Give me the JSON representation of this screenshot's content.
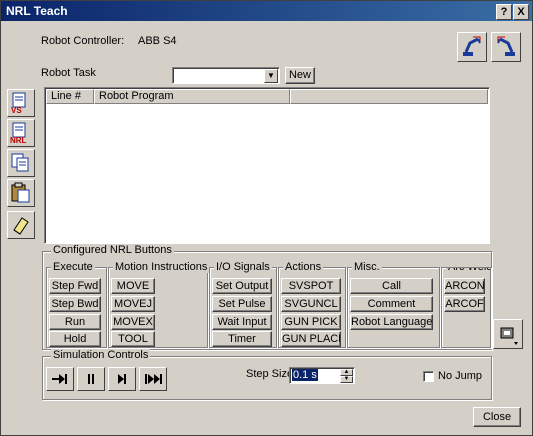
{
  "window": {
    "title": "NRL Teach",
    "help_label": "?",
    "close_label": "X"
  },
  "controller": {
    "label": "Robot Controller:",
    "value": "ABB S4"
  },
  "robot_task": {
    "label": "Robot Task",
    "value": "",
    "new_label": "New"
  },
  "program_table": {
    "columns": [
      "Line #",
      "Robot Program"
    ],
    "rows": []
  },
  "side_tools": [
    {
      "name": "vs-program-icon",
      "badge": "VS"
    },
    {
      "name": "nrl-program-icon",
      "badge": "NRL"
    },
    {
      "name": "copy-icon",
      "badge": ""
    },
    {
      "name": "paste-icon",
      "badge": ""
    },
    {
      "name": "eraser-icon",
      "badge": ""
    }
  ],
  "configured": {
    "title": "Configured NRL Buttons",
    "groups": [
      {
        "title": "Execute",
        "buttons": [
          "Step Fwd",
          "Step Bwd",
          "Run",
          "Hold"
        ]
      },
      {
        "title": "Motion Instructions",
        "buttons": [
          "MOVE",
          "MOVEJ",
          "MOVEX",
          "TOOL"
        ]
      },
      {
        "title": "I/O Signals",
        "buttons": [
          "Set Output",
          "Set Pulse",
          "Wait Input",
          "Timer"
        ]
      },
      {
        "title": "Actions",
        "buttons": [
          "SVSPOT",
          "SVGUNCL",
          "GUN PICK",
          "GUN PLACE"
        ]
      },
      {
        "title": "Misc.",
        "buttons": [
          "Call",
          "Comment",
          "Robot Language"
        ]
      },
      {
        "title": "Arc Weld",
        "buttons": [
          "ARCON",
          "ARCOF"
        ]
      }
    ]
  },
  "simulation": {
    "title": "Simulation Controls",
    "step_size_label": "Step Size",
    "step_size_value": "0.1 s",
    "no_jump_label": "No Jump",
    "no_jump_checked": false
  },
  "close_label": "Close",
  "colors": {
    "titlebar_start": "#0a246a",
    "titlebar_end": "#3a6ea5",
    "face": "#d4d0c8",
    "highlight_selection": "#0a246a"
  }
}
